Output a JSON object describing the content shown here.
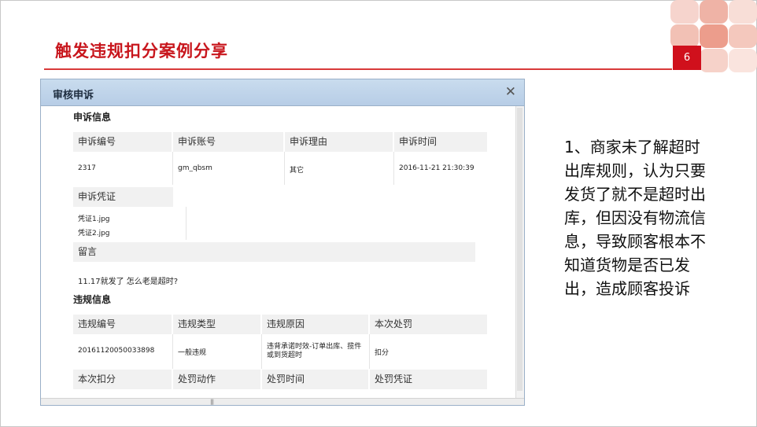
{
  "slide": {
    "title": "触发违规扣分案例分享",
    "page_number": "6",
    "accent_color": "#d0101c"
  },
  "dialog": {
    "title": "审核申诉",
    "close_icon": "close-icon",
    "appeal_section": {
      "title": "申诉信息",
      "headers": [
        "申诉编号",
        "申诉账号",
        "申诉理由",
        "申诉时间"
      ],
      "values": [
        "2317",
        "gm_qbsm",
        "其它",
        "2016-11-21 21:30:39"
      ],
      "evidence_label": "申诉凭证",
      "evidence_files": [
        "凭证1.jpg",
        "凭证2.jpg"
      ],
      "message_label": "留言",
      "message_text": "11.17就发了 怎么老是超时?"
    },
    "violation_section": {
      "title": "违规信息",
      "headers": [
        "违规编号",
        "违规类型",
        "违规原因",
        "本次处罚"
      ],
      "values": [
        "20161120050033898",
        "一般违规",
        "违背承诺时效-订单出库、揽件或到货超时",
        "扣分"
      ],
      "headers2": [
        "本次扣分",
        "处罚动作",
        "处罚时间",
        "处罚凭证"
      ]
    }
  },
  "note": {
    "text": "1、商家未了解超时出库规则，认为只要发货了就不是超时出库，但因没有物流信息，导致顾客根本不知道货物是否已发出，造成顾客投诉"
  }
}
